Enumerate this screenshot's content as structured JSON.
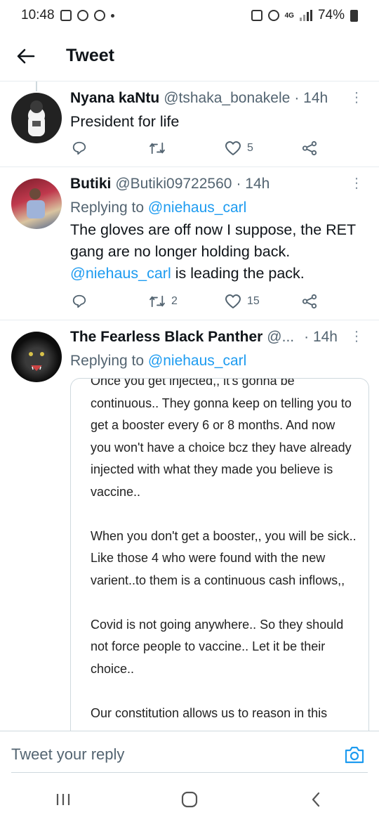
{
  "status_bar": {
    "time": "10:48",
    "network": "4G",
    "battery": "74%"
  },
  "header": {
    "title": "Tweet"
  },
  "tweets": [
    {
      "name": "Nyana kaNtu",
      "handle": "@tshaka_bonakele",
      "time": "· 14h",
      "text": "President for life",
      "retweets": "",
      "likes": "5"
    },
    {
      "name": "Butiki",
      "handle": "@Butiki09722560",
      "time": "· 14h",
      "replying_prefix": "Replying to",
      "replying_to": "@niehaus_carl",
      "text_part1": "The gloves are off now I suppose, the RET gang are no longer holding back.",
      "text_mention": "@niehaus_carl",
      "text_part2": " is leading the pack.",
      "retweets": "2",
      "likes": "15"
    },
    {
      "name": "The Fearless Black Panther",
      "handle": "@...",
      "time": "· 14h",
      "replying_prefix": "Replying to",
      "replying_to": "@niehaus_carl",
      "image_text": [
        "Once you get injected,, it's gonna be continuous.. They gonna keep on telling you to get a booster every 6 or 8 months. And now you won't have a choice bcz they have already injected with what they made you believe is vaccine..",
        "When you don't get a booster,, you will be sick.. Like those 4 who were found with the new varient..to them is a continuous cash inflows,,",
        "Covid is not going anywhere.. So they should not force people to vaccine.. Let it be their choice..",
        "Our constitution allows us to reason in this"
      ]
    }
  ],
  "reply_bar": {
    "placeholder": "Tweet your reply"
  },
  "colors": {
    "accent": "#1d9bf0",
    "secondary_text": "#536471",
    "divider": "#e6ecf0"
  },
  "icons": [
    "back-arrow-icon",
    "reply-icon",
    "retweet-icon",
    "like-icon",
    "share-icon",
    "more-icon",
    "camera-icon",
    "recent-apps-icon",
    "home-icon",
    "back-icon"
  ]
}
